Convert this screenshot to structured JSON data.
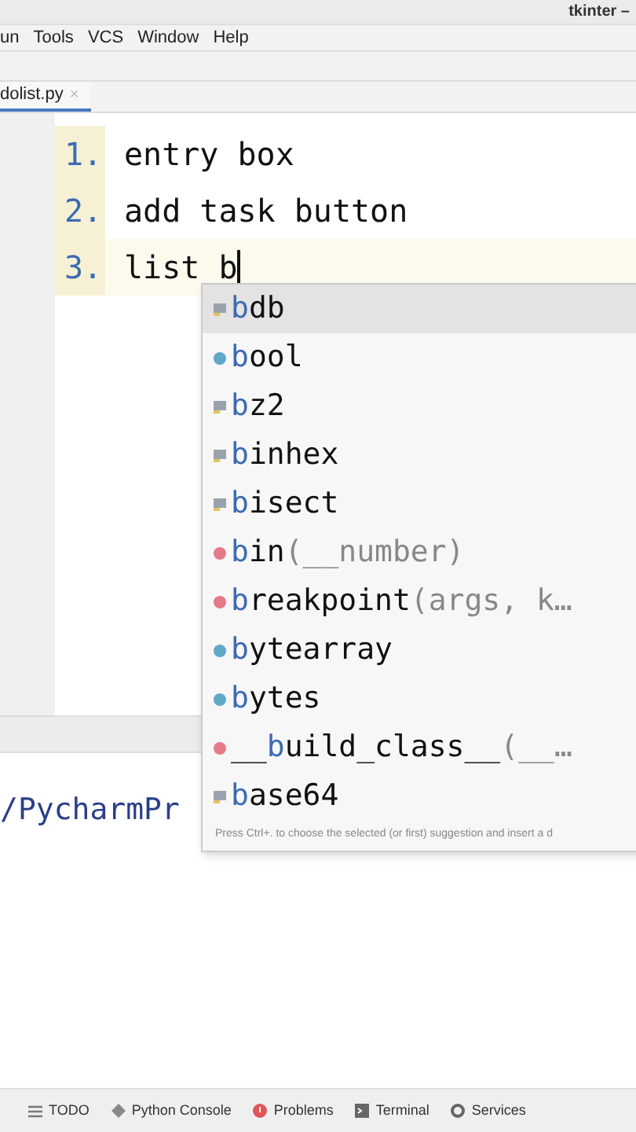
{
  "window": {
    "title": "tkinter –"
  },
  "menu": [
    "un",
    "Tools",
    "VCS",
    "Window",
    "Help"
  ],
  "tabs": [
    {
      "label": "dolist.py",
      "selected": true,
      "close": "×"
    }
  ],
  "editor": {
    "lines": [
      {
        "number": "1.",
        "text": "entry box",
        "current": false
      },
      {
        "number": "2.",
        "text": "add task button",
        "current": false
      },
      {
        "number": "3.",
        "text": "list b",
        "current": true
      }
    ]
  },
  "completion": {
    "items": [
      {
        "kind": "module",
        "match": "b",
        "name": "db",
        "selected": true
      },
      {
        "kind": "class",
        "match": "b",
        "name": "ool",
        "selected": false
      },
      {
        "kind": "module",
        "match": "b",
        "name": "z2",
        "selected": false
      },
      {
        "kind": "module",
        "match": "b",
        "name": "inhex",
        "selected": false
      },
      {
        "kind": "module",
        "match": "b",
        "name": "isect",
        "selected": false
      },
      {
        "kind": "function",
        "match": "b",
        "name": "in",
        "params": "(__number)",
        "selected": false
      },
      {
        "kind": "function",
        "match": "b",
        "name": "reakpoint",
        "params": "(args, k…",
        "selected": false
      },
      {
        "kind": "class",
        "match": "b",
        "name": "ytearray",
        "selected": false
      },
      {
        "kind": "class",
        "match": "b",
        "name": "ytes",
        "selected": false
      },
      {
        "kind": "function",
        "lead": "__",
        "match": "b",
        "name": "uild_class__",
        "params": "(__…",
        "selected": false
      },
      {
        "kind": "module",
        "match": "b",
        "name": "ase64",
        "selected": false
      }
    ],
    "hint": "Press Ctrl+. to choose the selected (or first) suggestion and insert a d"
  },
  "terminal": {
    "path": "/PycharmPr"
  },
  "tool_windows": [
    {
      "kind": "list",
      "label": "TODO"
    },
    {
      "kind": "console",
      "label": "Python Console"
    },
    {
      "kind": "problems",
      "label": "Problems"
    },
    {
      "kind": "terminal",
      "label": "Terminal"
    },
    {
      "kind": "services",
      "label": "Services"
    }
  ]
}
